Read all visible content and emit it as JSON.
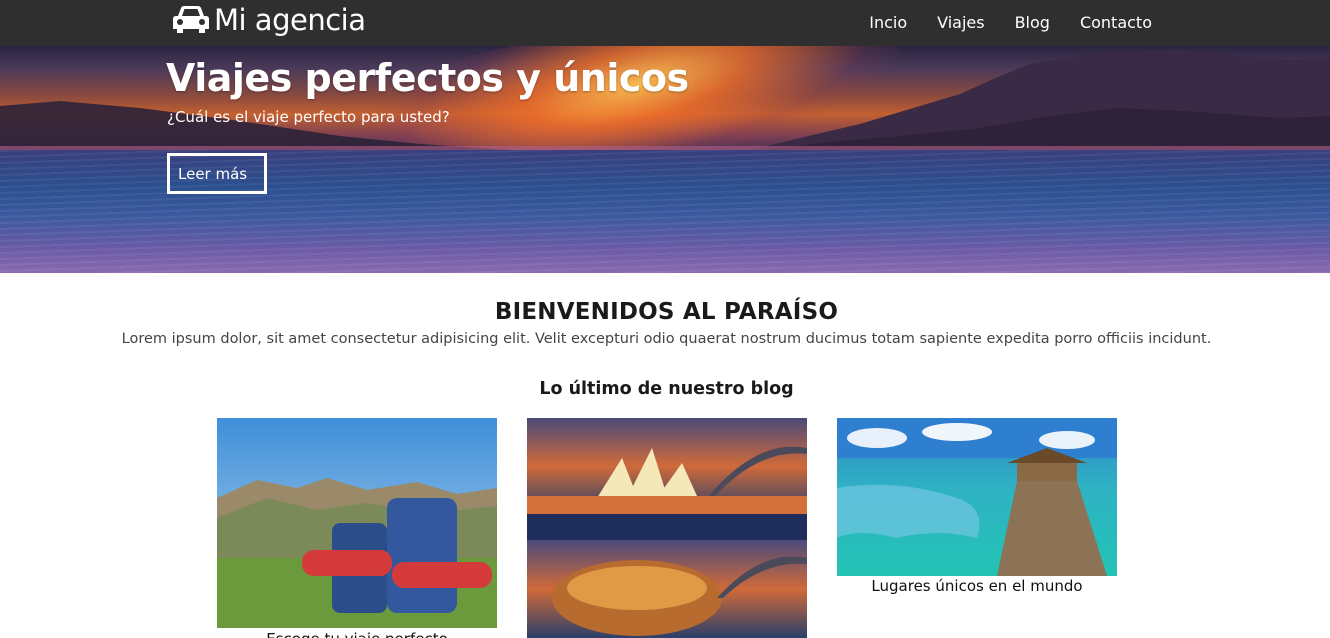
{
  "brand": {
    "name": "Mi agencia",
    "icon": "car-icon"
  },
  "nav": {
    "items": [
      {
        "label": "Incio"
      },
      {
        "label": "Viajes"
      },
      {
        "label": "Blog"
      },
      {
        "label": "Contacto"
      }
    ]
  },
  "hero": {
    "title": "Viajes perfectos y únicos",
    "subtitle": "¿Cuál es el viaje perfecto para usted?",
    "button_label": "Leer más"
  },
  "welcome": {
    "title": "BIENVENIDOS AL PARAÍSO",
    "text": "Lorem ipsum dolor, sit amet consectetur adipisicing elit. Velit excepturi odio quaerat nostrum ducimus totam sapiente expedita porro officiis incidunt."
  },
  "blog": {
    "heading": "Lo último de nuestro blog",
    "posts": [
      {
        "caption": "Escoge tu viaje perfecto"
      },
      {
        "caption": ""
      },
      {
        "caption": "Lugares únicos en el mundo"
      }
    ]
  },
  "colors": {
    "navbar": "#2f2f2f",
    "text": "#1a1a1a",
    "hero_text": "#ffffff"
  }
}
